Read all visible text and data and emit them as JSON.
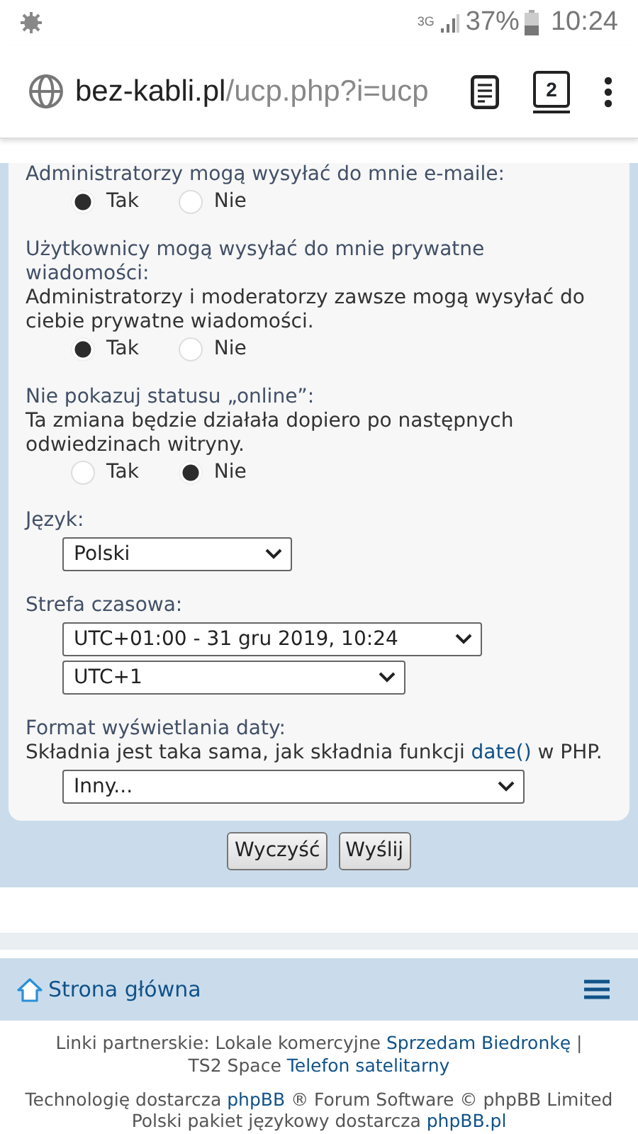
{
  "status_bar": {
    "network": "3G",
    "battery": "37%",
    "time": "10:24"
  },
  "browser": {
    "url_host": "bez-kabli.pl",
    "url_path": "/ucp.php?i=ucp",
    "tabs_count": "2"
  },
  "settings": [
    {
      "kind": "radio",
      "label": "Administratorzy mogą wysyłać do mnie e-maile:",
      "options": [
        {
          "label": "Tak",
          "selected": true
        },
        {
          "label": "Nie",
          "selected": false
        }
      ]
    },
    {
      "kind": "radio",
      "label": "Użytkownicy mogą wysyłać do mnie prywatne wiadomości:",
      "explain": [
        {
          "text": "Administratorzy i moderatorzy zawsze mogą wysyłać do ciebie prywatne wiadomości.",
          "kind": "text"
        }
      ],
      "options": [
        {
          "label": "Tak",
          "selected": true
        },
        {
          "label": "Nie",
          "selected": false
        }
      ]
    },
    {
      "kind": "radio",
      "label": "Nie pokazuj statusu „online”:",
      "explain": [
        {
          "text": "Ta zmiana będzie działała dopiero po następnych odwiedzinach witryny.",
          "kind": "text"
        }
      ],
      "options": [
        {
          "label": "Tak",
          "selected": false
        },
        {
          "label": "Nie",
          "selected": true
        }
      ]
    },
    {
      "kind": "select",
      "label": "Język:",
      "selects": [
        {
          "value": "Polski"
        }
      ]
    },
    {
      "kind": "select",
      "label": "Strefa czasowa:",
      "selects": [
        {
          "value": "UTC+01:00 - 31 gru 2019, 10:24"
        },
        {
          "value": "UTC+1"
        }
      ]
    },
    {
      "kind": "select",
      "label": "Format wyświetlania daty:",
      "explain": [
        {
          "text": "Składnia jest taka sama, jak składnia funkcji",
          "kind": "text"
        },
        {
          "text": "date()",
          "kind": "link"
        },
        {
          "text": "w PHP.",
          "kind": "text"
        }
      ],
      "selects": [
        {
          "value": "Inny..."
        }
      ]
    }
  ],
  "buttons": [
    "Wyczyść",
    "Wyślij"
  ],
  "footer_nav": {
    "home": "Strona główna"
  },
  "partner_links": [
    {
      "text": "Linki partnerskie: Lokale komercyjne",
      "kind": "text"
    },
    {
      "text": "Sprzedam Biedronkę",
      "kind": "link"
    },
    {
      "text": "|",
      "kind": "text"
    },
    {
      "text": "TS2 Space",
      "kind": "text"
    },
    {
      "text": "Telefon satelitarny",
      "kind": "link"
    }
  ],
  "credits": [
    [
      {
        "text": "Technologię dostarcza",
        "kind": "text"
      },
      {
        "text": "phpBB",
        "kind": "link"
      },
      {
        "text": "® Forum Software © phpBB Limited",
        "kind": "text"
      }
    ],
    [
      {
        "text": "Polski pakiet językowy dostarcza",
        "kind": "text"
      },
      {
        "text": "phpBB.pl",
        "kind": "link"
      }
    ]
  ]
}
